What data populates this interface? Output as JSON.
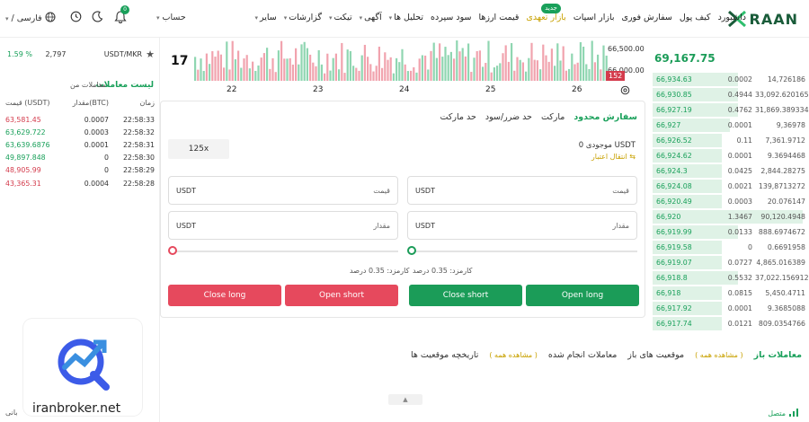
{
  "header": {
    "logo_text": "RAAN",
    "nav": [
      {
        "label": "داشبورد"
      },
      {
        "label": "کیف پول"
      },
      {
        "label": "سفارش فوری"
      },
      {
        "label": "بازار اسپات"
      },
      {
        "label": "بازار تعهدی",
        "active": true,
        "badge": "جدید"
      },
      {
        "label": "قیمت ارزها"
      },
      {
        "label": "سود سپرده"
      },
      {
        "label": "تحلیل ها",
        "caret": true
      },
      {
        "label": "آگهی",
        "caret": true
      },
      {
        "label": "تیکت",
        "caret": true
      },
      {
        "label": "گزارشات",
        "caret": true
      },
      {
        "label": "سایر",
        "caret": true
      }
    ],
    "account_label": "حساب",
    "notification_count": "0",
    "language_label": "/ فارسی"
  },
  "ticker": {
    "pair": "USDT/MKR",
    "price": "2,797",
    "change": "1.59 %"
  },
  "trades": {
    "title": "لیست معاملات",
    "my_trades": "معاملات من",
    "col_price": "قیمت (USDT)",
    "col_amount": "مقدار(BTC)",
    "col_time": "زمان",
    "rows": [
      {
        "price": "63,581.45",
        "amount": "0.0007",
        "time": "22:58:33",
        "side": "red"
      },
      {
        "price": "63,629.722",
        "amount": "0.0003",
        "time": "22:58:32",
        "side": "green"
      },
      {
        "price": "63,639.6876",
        "amount": "0.0001",
        "time": "22:58:31",
        "side": "green"
      },
      {
        "price": "49,897.848",
        "amount": "0",
        "time": "22:58:30",
        "side": "green"
      },
      {
        "price": "48,905.99",
        "amount": "0",
        "time": "22:58:29",
        "side": "red"
      },
      {
        "price": "43,365.31",
        "amount": "0.0004",
        "time": "22:58:28",
        "side": "red"
      }
    ]
  },
  "chart": {
    "price_level_1": "66,500.00",
    "price_level_2": "66,000.00",
    "price_tag": "152",
    "x_labels": [
      "22",
      "23",
      "24",
      "25",
      "26"
    ],
    "tv_logo": "17"
  },
  "order_form": {
    "tabs": [
      {
        "label": "سفارش محدود",
        "active": true
      },
      {
        "label": "مارکت"
      },
      {
        "label": "حد ضرر/سود"
      },
      {
        "label": "حد مارکت"
      }
    ],
    "balance": "موجودی 0 USDT",
    "transfer": "انتقال اعتبار",
    "leverage": "125x",
    "price_label": "قیمت",
    "amount_label": "مقدار",
    "unit": "USDT",
    "fee": "کارمزد: 0.35 درصد",
    "buttons": {
      "open_long": "Open long",
      "close_short": "Close short",
      "open_short": "Open short",
      "close_long": "Close long"
    }
  },
  "order_book": {
    "last_price": "69,167.75",
    "rows": [
      {
        "price": "66,934.63",
        "amount": "0.0002",
        "total": "14,726186",
        "fill": 0.55
      },
      {
        "price": "66,930.85",
        "amount": "0.4944",
        "total": "33,092.6201655",
        "fill": 0.55
      },
      {
        "price": "66,927.19",
        "amount": "0.4762",
        "total": "31,869.3893342",
        "fill": 0.55
      },
      {
        "price": "66,927",
        "amount": "0.0001",
        "total": "9,36978",
        "fill": 0.5
      },
      {
        "price": "66,926.52",
        "amount": "0.11",
        "total": "7,361.9712",
        "fill": 0.45
      },
      {
        "price": "66,924.62",
        "amount": "0.0001",
        "total": "9.3694468",
        "fill": 0.45
      },
      {
        "price": "66,924.3",
        "amount": "0.0425",
        "total": "2,844.28275",
        "fill": 0.45
      },
      {
        "price": "66,924.08",
        "amount": "0.0021",
        "total": "139,8713272",
        "fill": 0.45
      },
      {
        "price": "66,920.49",
        "amount": "0.0003",
        "total": "20.076147",
        "fill": 0.45
      },
      {
        "price": "66,920",
        "amount": "1.3467",
        "total": "90,120.4948",
        "fill": 0.97
      },
      {
        "price": "66,919.99",
        "amount": "0.0133",
        "total": "888.6974672",
        "fill": 0.55
      },
      {
        "price": "66,919.58",
        "amount": "0",
        "total": "0.6691958",
        "fill": 0.45
      },
      {
        "price": "66,919.07",
        "amount": "0.0727",
        "total": "4,865.016389",
        "fill": 0.45
      },
      {
        "price": "66,918.8",
        "amount": "0.5532",
        "total": "37,022.156912",
        "fill": 0.55
      },
      {
        "price": "66,918",
        "amount": "0.0815",
        "total": "5,450.4711",
        "fill": 0.45
      },
      {
        "price": "66,917.92",
        "amount": "0.0001",
        "total": "9.3685088",
        "fill": 0.45
      },
      {
        "price": "66,917.74",
        "amount": "0.0121",
        "total": "809.0354766",
        "fill": 0.45
      }
    ]
  },
  "bottom_tabs": {
    "open_trades": "معاملات باز",
    "see_all": "( مشاهده همه )",
    "open_positions": "موقعیت های باز",
    "executed_trades": "معاملات انجام شده",
    "positions_history": "تاریخچه موقعیت ها"
  },
  "status": {
    "connection": "متصل",
    "footer_left": "بانی"
  },
  "watermark": {
    "text": "iranbroker.net"
  },
  "colors": {
    "green": "#1b9c58",
    "red": "#e6495d",
    "gold": "#c8a100"
  }
}
